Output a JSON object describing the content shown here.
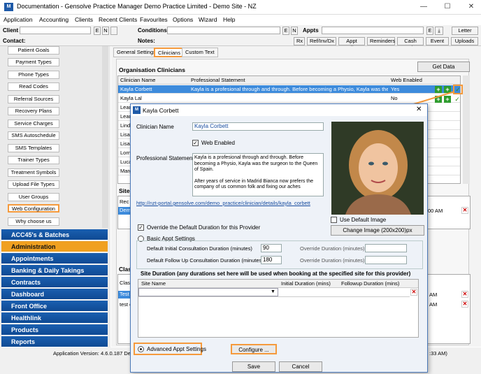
{
  "window": {
    "title": "Documentation - Gensolve Practice Manager     Demo Practice Limited - Demo Site - NZ",
    "app_icon": "Gensolve app icon"
  },
  "menu": [
    "Application",
    "Accounting",
    "Clients",
    "Recent Clients",
    "Favourites",
    "Options",
    "Wizard",
    "Help"
  ],
  "toolbar": {
    "client_label": "Client",
    "contact_label": "Contact:",
    "conditions_label": "Conditions",
    "notes_label": "Notes:",
    "appts_label": "Appts",
    "mini_e": "E",
    "mini_n": "N",
    "letter": "Letter",
    "buttons": [
      "Rx",
      "Ref/Inv/Dx",
      "Appt Slip",
      "Reminders",
      "Cash Sale",
      "Event",
      "Uploads"
    ]
  },
  "sidebar": {
    "items": [
      "Patient Goals",
      "Payment Types",
      "Phone Types",
      "Read Codes",
      "Referral Sources",
      "Recovery Plans",
      "Service Charges",
      "SMS Autoschedule",
      "SMS Templates",
      "Trainer Types",
      "Treatment Symbols",
      "Upload File Types",
      "User Groups",
      "Web Configuration",
      "Why choose us"
    ],
    "nav": [
      "ACC45's & Batches",
      "Administration",
      "Appointments",
      "Banking & Daily Takings",
      "Contracts",
      "Dashboard",
      "Front Office",
      "Healthlink",
      "Products",
      "Reports"
    ]
  },
  "tabs": [
    "General Settings",
    "Clinicians",
    "Custom Text"
  ],
  "clinicians": {
    "section_title": "Organisation Clinicians",
    "get_data": "Get Data",
    "headers": [
      "Clinician Name",
      "Professional Statement",
      "Web Enabled"
    ],
    "rows": [
      {
        "name": "Kayla Corbett",
        "statement": "Kayla is a profesional through and through.  Before becoming a Physio, Kayla was the ...",
        "web": "Yes"
      },
      {
        "name": "Kayla Lal",
        "statement": "",
        "web": "No"
      },
      {
        "name": "Lean",
        "statement": "",
        "web": ""
      },
      {
        "name": "Lean",
        "statement": "",
        "web": ""
      },
      {
        "name": "Linds",
        "statement": "",
        "web": ""
      },
      {
        "name": "Lisa",
        "statement": "",
        "web": ""
      },
      {
        "name": "Lisa",
        "statement": "",
        "web": ""
      },
      {
        "name": "Lorna",
        "statement": "",
        "web": ""
      },
      {
        "name": "Luca",
        "statement": "",
        "web": ""
      },
      {
        "name": "Marg",
        "statement": "",
        "web": ""
      }
    ]
  },
  "site_section": {
    "title": "Site",
    "row1_label": "Rec",
    "row2_label": "Demo",
    "time": "00 AM"
  },
  "class_section": {
    "title": "Clas",
    "header": "Clas",
    "rows": [
      {
        "label": "Test",
        "time": "AM"
      },
      {
        "label": "test c",
        "time": "AM"
      }
    ]
  },
  "status": {
    "version": "Application Version: 4.6.0.187 Del",
    "time": ":33 AM)"
  },
  "dialog": {
    "title": "Kayla Corbett",
    "clinician_name_label": "Clinician Name",
    "clinician_name": "Kayla Corbett",
    "web_enabled_label": "Web Enabled",
    "professional_statement_label": "Professional Statement",
    "statement_p1": "Kayla is a profesional through and through.  Before becoming a Physio, Kayla was the surgeon to the Queen of Spain.",
    "statement_p2": "After years of service in Madrid Bianca now prefers the company of us common folk and fixing our aches",
    "url": "http://nzt-portal.gensolve.com/demo_practice/clinician/details/kayla_corbett",
    "use_default_image": "Use Default Image",
    "change_image": "Change Image (200x200)px",
    "override_label": "Override the Default Duration for this Provider",
    "basic_label": "Basic Appt Settings",
    "initial_label": "Default Initial Consultation Duration (minutes)",
    "initial_value": "90",
    "followup_label": "Default Follow Up Consultation Duration (minutes)",
    "followup_value": "180",
    "override_dur_label": "Override Duration (minutes)",
    "site_duration_title": "Site Duration (any durations set here will be used when booking at the specified site for this provider)",
    "site_headers": [
      "Site Name",
      "Initial Duration (mins)",
      "Followup Duration (mins)"
    ],
    "advanced_label": "Advanced Appt Settings",
    "configure": "Configure ...",
    "save": "Save",
    "cancel": "Cancel"
  }
}
